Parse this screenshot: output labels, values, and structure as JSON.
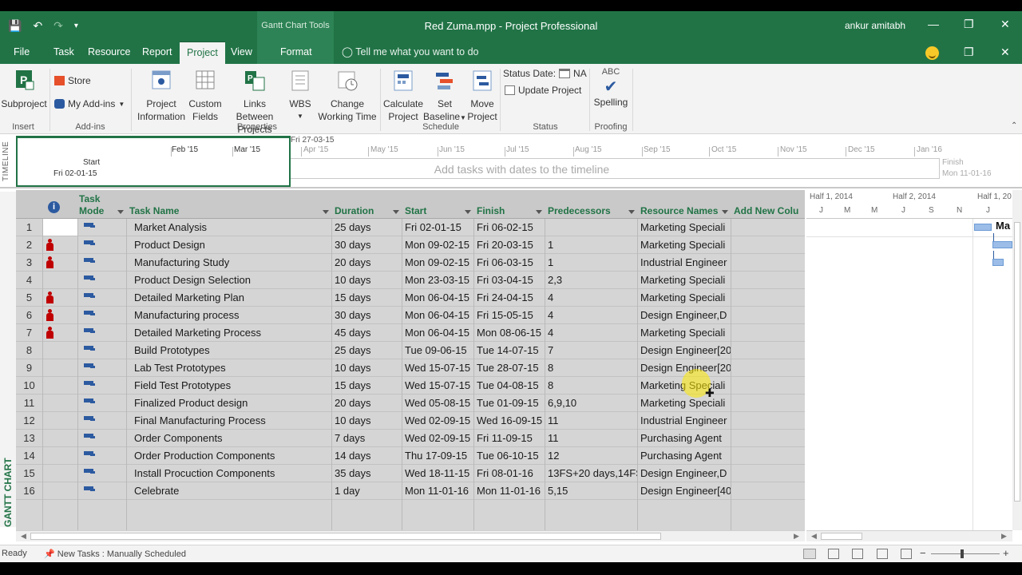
{
  "window": {
    "title": "Red Zuma.mpp  -  Project Professional",
    "context_group": "Gantt Chart Tools",
    "user": "ankur amitabh",
    "controls": [
      "—",
      "❐",
      "✕"
    ]
  },
  "tabs": [
    {
      "label": "File"
    },
    {
      "label": "Task"
    },
    {
      "label": "Resource"
    },
    {
      "label": "Report"
    },
    {
      "label": "Project",
      "active": true
    },
    {
      "label": "View"
    },
    {
      "label": "Format"
    }
  ],
  "tell_me": "Tell me what you want to do",
  "ribbon": {
    "insert": {
      "subproject": "Subproject",
      "group": "Insert"
    },
    "addins": {
      "store": "Store",
      "my_addins": "My Add-ins",
      "group": "Add-ins"
    },
    "properties": {
      "project_information": [
        "Project",
        "Information"
      ],
      "custom_fields": [
        "Custom",
        "Fields"
      ],
      "links_between_projects": [
        "Links Between",
        "Projects"
      ],
      "wbs": "WBS",
      "change_working_time": [
        "Change",
        "Working Time"
      ],
      "group": "Properties"
    },
    "schedule": {
      "calculate_project": [
        "Calculate",
        "Project"
      ],
      "set_baseline": [
        "Set",
        "Baseline"
      ],
      "move_project": [
        "Move",
        "Project"
      ],
      "group": "Schedule"
    },
    "status": {
      "status_date_label": "Status Date:",
      "status_date_value": "NA",
      "update_project": "Update Project",
      "group": "Status"
    },
    "proofing": {
      "abc": "ABC",
      "spelling": "Spelling",
      "group": "Proofing"
    }
  },
  "timeline": {
    "label": "TIMELINE",
    "start_label": "Start",
    "start_date": "Fri 02-01-15",
    "current_marker": "Fri 27-03-15",
    "months": [
      "Feb '15",
      "Mar '15",
      "Apr '15",
      "May '15",
      "Jun '15",
      "Jul '15",
      "Aug '15",
      "Sep '15",
      "Oct '15",
      "Nov '15",
      "Dec '15",
      "Jan '16"
    ],
    "placeholder": "Add tasks with dates to the timeline",
    "finish_label": "Finish",
    "finish_date": "Mon 11-01-16"
  },
  "view_label": "GANTT CHART",
  "grid": {
    "headers": {
      "info": "i",
      "task_mode": [
        "Task",
        "Mode"
      ],
      "task_name": "Task Name",
      "duration": "Duration",
      "start": "Start",
      "finish": "Finish",
      "predecessors": "Predecessors",
      "resource_names": "Resource Names",
      "add_new_column": "Add New Colu"
    },
    "rows": [
      {
        "id": "1",
        "indicator": false,
        "name": "Market Analysis",
        "duration": "25 days",
        "start": "Fri 02-01-15",
        "finish": "Fri 06-02-15",
        "pred": "",
        "resources": "Marketing Speciali"
      },
      {
        "id": "2",
        "indicator": true,
        "name": "Product Design",
        "duration": "30 days",
        "start": "Mon 09-02-15",
        "finish": "Fri 20-03-15",
        "pred": "1",
        "resources": "Marketing Speciali"
      },
      {
        "id": "3",
        "indicator": true,
        "name": "Manufacturing Study",
        "duration": "20 days",
        "start": "Mon 09-02-15",
        "finish": "Fri 06-03-15",
        "pred": "1",
        "resources": "Industrial Engineer"
      },
      {
        "id": "4",
        "indicator": false,
        "name": "Product Design Selection",
        "duration": "10 days",
        "start": "Mon 23-03-15",
        "finish": "Fri 03-04-15",
        "pred": "2,3",
        "resources": "Marketing Speciali"
      },
      {
        "id": "5",
        "indicator": true,
        "name": "Detailed Marketing Plan",
        "duration": "15 days",
        "start": "Mon 06-04-15",
        "finish": "Fri 24-04-15",
        "pred": "4",
        "resources": "Marketing Speciali"
      },
      {
        "id": "6",
        "indicator": true,
        "name": "Manufacturing process",
        "duration": "30 days",
        "start": "Mon 06-04-15",
        "finish": "Fri 15-05-15",
        "pred": "4",
        "resources": "Design Engineer,D"
      },
      {
        "id": "7",
        "indicator": true,
        "name": "Detailed Marketing Process",
        "duration": "45 days",
        "start": "Mon 06-04-15",
        "finish": "Mon 08-06-15",
        "pred": "4",
        "resources": "Marketing Speciali"
      },
      {
        "id": "8",
        "indicator": false,
        "name": "Build Prototypes",
        "duration": "25 days",
        "start": "Tue 09-06-15",
        "finish": "Tue 14-07-15",
        "pred": "7",
        "resources": "Design Engineer[20"
      },
      {
        "id": "9",
        "indicator": false,
        "name": "Lab Test Prototypes",
        "duration": "10 days",
        "start": "Wed 15-07-15",
        "finish": "Tue 28-07-15",
        "pred": "8",
        "resources": "Design Engineer[20"
      },
      {
        "id": "10",
        "indicator": false,
        "name": "Field Test Prototypes",
        "duration": "15 days",
        "start": "Wed 15-07-15",
        "finish": "Tue 04-08-15",
        "pred": "8",
        "resources": "Marketing Speciali"
      },
      {
        "id": "11",
        "indicator": false,
        "name": "Finalized Product design",
        "duration": "20 days",
        "start": "Wed 05-08-15",
        "finish": "Tue 01-09-15",
        "pred": "6,9,10",
        "resources": "Marketing Speciali"
      },
      {
        "id": "12",
        "indicator": false,
        "name": "Final Manufacturing Process",
        "duration": "10 days",
        "start": "Wed 02-09-15",
        "finish": "Wed 16-09-15",
        "pred": "11",
        "resources": "Industrial Engineer"
      },
      {
        "id": "13",
        "indicator": false,
        "name": "Order Components",
        "duration": "7 days",
        "start": "Wed 02-09-15",
        "finish": "Fri 11-09-15",
        "pred": "11",
        "resources": "Purchasing Agent"
      },
      {
        "id": "14",
        "indicator": false,
        "name": "Order Production Components",
        "duration": "14 days",
        "start": "Thu 17-09-15",
        "finish": "Tue 06-10-15",
        "pred": "12",
        "resources": "Purchasing Agent"
      },
      {
        "id": "15",
        "indicator": false,
        "name": "Install Procuction Components",
        "duration": "35 days",
        "start": "Wed 18-11-15",
        "finish": "Fri 08-01-16",
        "pred": "13FS+20 days,14FS",
        "resources": "Design Engineer,D"
      },
      {
        "id": "16",
        "indicator": false,
        "name": "Celebrate",
        "duration": "1 day",
        "start": "Mon 11-01-16",
        "finish": "Mon 11-01-16",
        "pred": "5,15",
        "resources": "Design Engineer[40"
      }
    ]
  },
  "chart": {
    "periods": [
      "Half 1, 2014",
      "Half 2, 2014",
      "Half 1, 20"
    ],
    "units": [
      "J",
      "M",
      "M",
      "J",
      "S",
      "N",
      "J"
    ],
    "first_label": "Ma"
  },
  "status_bar": {
    "ready": "Ready",
    "new_tasks": "New Tasks : Manually Scheduled"
  }
}
